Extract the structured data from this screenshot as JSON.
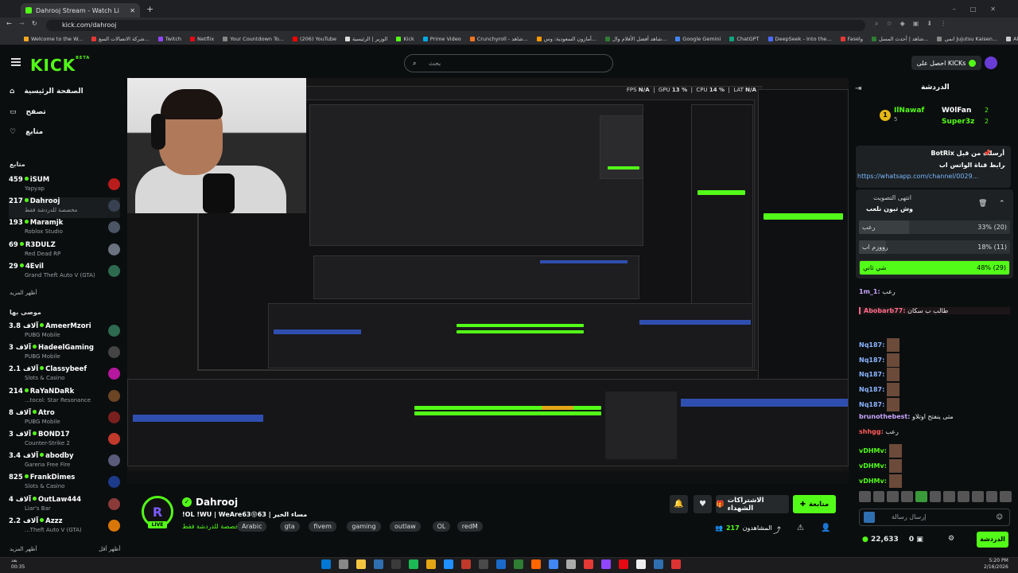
{
  "browser": {
    "tab_title": "Dahrooj Stream - Watch Li",
    "url": "kick.com/dahrooj",
    "bookmarks": [
      "Welcome to the W...",
      "شركة الاتصالات السع...",
      "Twitch",
      "Netflix",
      "Your Countdown To...",
      "(206) YouTube",
      "الوزير | الرئيسية",
      "Kick",
      "Prime Video",
      "Crunchyroll - شاهد...",
      "أمازون السعودية: وس...",
      "شاهد أفضل الأفلام وال...",
      "Google Gemini",
      "ChatGPT",
      "DeepSeek - Into the...",
      "Faselو",
      "شاهد | أحدث المسل...",
      "انمي Jujutsu Kaisen...",
      "All Bookmarks"
    ]
  },
  "header": {
    "logo": "KICK",
    "logo_sup": "BETA",
    "search_placeholder": "بحث",
    "get_kicks": "احصل على KICKs"
  },
  "sidebar": {
    "nav": [
      {
        "label": "الصفحة الرئيسية",
        "icon": "home-icon"
      },
      {
        "label": "تصفح",
        "icon": "browse-icon"
      },
      {
        "label": "متابع",
        "icon": "heart-icon"
      }
    ],
    "following_title": "متابع",
    "following": [
      {
        "viewers": "459",
        "name": "iSUM",
        "game": "Yapyap"
      },
      {
        "viewers": "217",
        "name": "Dahrooj",
        "game": "مخصصة للدردشة فقط"
      },
      {
        "viewers": "193",
        "name": "Maramjk",
        "game": "Roblox Studio"
      },
      {
        "viewers": "69",
        "name": "R3DULZ",
        "game": "Red Dead RP"
      },
      {
        "viewers": "29",
        "name": "4Evil",
        "game": "Grand Theft Auto V (GTA)"
      }
    ],
    "show_more": "أظهر المزيد",
    "recommended_title": "موصى بها",
    "recommended": [
      {
        "viewers": "3.8 آلاف",
        "name": "AmeerMzori",
        "game": "PUBG Mobile"
      },
      {
        "viewers": "3 آلاف",
        "name": "HadeelGaming",
        "game": "PUBG Mobile"
      },
      {
        "viewers": "2.1 آلاف",
        "name": "Classybeef",
        "game": "Slots & Casino"
      },
      {
        "viewers": "214",
        "name": "RaYaNDaRk",
        "game": "...tocol: Star Resonance"
      },
      {
        "viewers": "8 آلاف",
        "name": "Atro",
        "game": "PUBG Mobile"
      },
      {
        "viewers": "3 آلاف",
        "name": "BOND17",
        "game": "Counter-Strike 2"
      },
      {
        "viewers": "3.4 آلاف",
        "name": "abodby",
        "game": "Garena Free Fire"
      },
      {
        "viewers": "825",
        "name": "FrankDimes",
        "game": "Slots & Casino"
      },
      {
        "viewers": "4 آلاف",
        "name": "OutLaw444",
        "game": "Liar's Bar"
      },
      {
        "viewers": "2.2 آلاف",
        "name": "Azzz",
        "game": "...Theft Auto V (GTA)"
      }
    ],
    "show_more2": "أظهر المزيد",
    "show_less": "أظهر أقل"
  },
  "stream": {
    "streamer": "Dahrooj",
    "title": "!OL !WU | WeAre63😝63 | مساء الخير",
    "category": "مخصصة للدردشة فقط",
    "tags": [
      "Arabic",
      "gta",
      "fivem",
      "gaming",
      "outlaw",
      "OL",
      "redM"
    ],
    "follow": "متابعة",
    "subscribe": "الاشتراكات الشهداء",
    "viewers": "217",
    "viewers_label": "المشاهدون",
    "live": "LIVE"
  },
  "obs": {
    "fps_label": "FPS",
    "fps": "N/A",
    "gpu_label": "GPU",
    "gpu": "13 %",
    "cpu_label": "CPU",
    "cpu": "14 %",
    "lat_label": "LAT",
    "lat": "N/A"
  },
  "chat": {
    "title": "الدردشة",
    "gifters": [
      {
        "rank": "1",
        "name": "IlNawaf",
        "count": "5"
      },
      {
        "rank": "",
        "name": "W0lFan",
        "count": "2"
      },
      {
        "rank": "",
        "name": "Super3z",
        "count": "2"
      }
    ],
    "pinned_by": "BotRix أرسلت من قبل",
    "pinned_text": "رابط قناة الواتس اب",
    "pinned_link": "https://whatsapp.com/channel/0029...",
    "poll_status": "انتهى التصويت",
    "poll_question": "وش تبون نلعب",
    "poll_options": [
      {
        "label": "رعب",
        "pct": 33,
        "text": "33% (20)",
        "winner": false
      },
      {
        "label": "رووزم اب",
        "pct": 18,
        "text": "18% (11)",
        "winner": false
      },
      {
        "label": "شي ثاني",
        "pct": 48,
        "text": "48% (29)",
        "winner": true
      }
    ],
    "messages": [
      {
        "user": "1m_1",
        "text": "رعب",
        "color": "#c9a6ff"
      },
      {
        "user": "Abobarb77",
        "text": "طالب ب سكان",
        "color": "#ff6b8a"
      },
      {
        "user": "Nq187",
        "text": "",
        "color": "#8ab4ff"
      },
      {
        "user": "Nq187",
        "text": "",
        "color": "#8ab4ff"
      },
      {
        "user": "Nq187",
        "text": "",
        "color": "#8ab4ff"
      },
      {
        "user": "Nq187",
        "text": "",
        "color": "#8ab4ff"
      },
      {
        "user": "Nq187",
        "text": "",
        "color": "#8ab4ff"
      },
      {
        "user": "brunothebest",
        "text": "متى ينفتح اوتلاو",
        "color": "#c9a6ff"
      },
      {
        "user": "shhgg",
        "text": "رعب",
        "color": "#ff5a5a"
      },
      {
        "user": "vDHMv",
        "text": "",
        "color": "#53fc18"
      },
      {
        "user": "vDHMv",
        "text": "",
        "color": "#53fc18"
      },
      {
        "user": "vDHMv",
        "text": "",
        "color": "#53fc18"
      }
    ],
    "input_placeholder": "إرسال رسالة",
    "send": "الدردشة",
    "points": "22,633",
    "zero": "0"
  },
  "taskbar": {
    "weather_temp": "بعد",
    "weather_line2": "00:35",
    "time": "5:20 PM",
    "date": "2/16/2026"
  },
  "colors": {
    "accent": "#53fc18",
    "bg": "#0b0e0f"
  }
}
